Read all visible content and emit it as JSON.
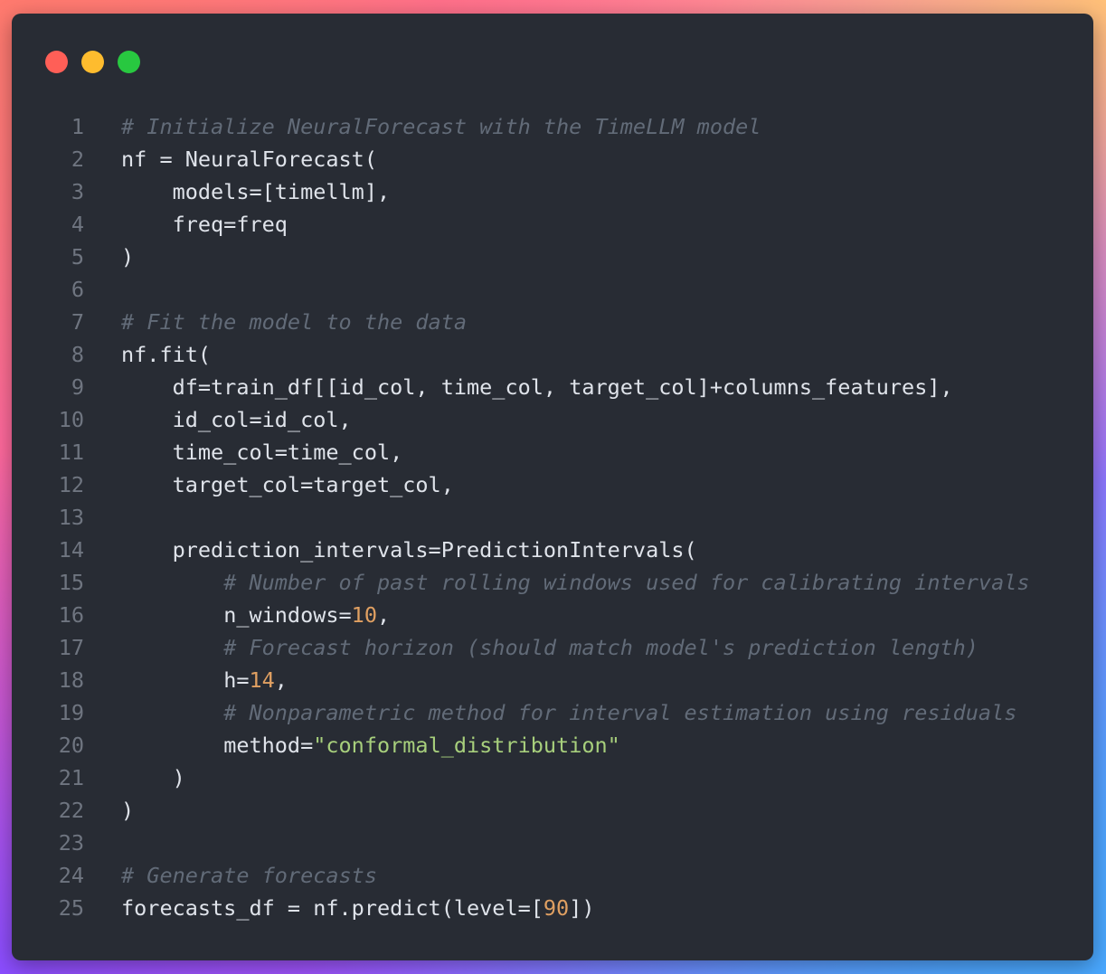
{
  "window": {
    "controls": [
      {
        "name": "close",
        "color": "#ff5f57"
      },
      {
        "name": "minimize",
        "color": "#febc2e"
      },
      {
        "name": "zoom",
        "color": "#28c840"
      }
    ]
  },
  "colors": {
    "background": "#282c34",
    "comment": "#626b78",
    "number": "#e0a062",
    "string": "#a7cf7c",
    "text": "#dfe3ea",
    "line_number": "#6f7580"
  },
  "code": {
    "lines": [
      {
        "n": "1",
        "indent": "",
        "tokens": [
          {
            "t": "comment",
            "v": "# Initialize NeuralForecast with the TimeLLM model"
          }
        ]
      },
      {
        "n": "2",
        "indent": "",
        "tokens": [
          {
            "t": "plain",
            "v": "nf = NeuralForecast("
          }
        ]
      },
      {
        "n": "3",
        "indent": "    ",
        "tokens": [
          {
            "t": "plain",
            "v": "models=[timellm],"
          }
        ]
      },
      {
        "n": "4",
        "indent": "    ",
        "tokens": [
          {
            "t": "plain",
            "v": "freq=freq"
          }
        ]
      },
      {
        "n": "5",
        "indent": "",
        "tokens": [
          {
            "t": "plain",
            "v": ")"
          }
        ]
      },
      {
        "n": "6",
        "indent": "",
        "tokens": []
      },
      {
        "n": "7",
        "indent": "",
        "tokens": [
          {
            "t": "comment",
            "v": "# Fit the model to the data"
          }
        ]
      },
      {
        "n": "8",
        "indent": "",
        "tokens": [
          {
            "t": "plain",
            "v": "nf.fit("
          }
        ]
      },
      {
        "n": "9",
        "indent": "    ",
        "tokens": [
          {
            "t": "plain",
            "v": "df=train_df[[id_col, time_col, target_col]+columns_features],"
          }
        ]
      },
      {
        "n": "10",
        "indent": "    ",
        "tokens": [
          {
            "t": "plain",
            "v": "id_col=id_col,"
          }
        ]
      },
      {
        "n": "11",
        "indent": "    ",
        "tokens": [
          {
            "t": "plain",
            "v": "time_col=time_col,"
          }
        ]
      },
      {
        "n": "12",
        "indent": "    ",
        "tokens": [
          {
            "t": "plain",
            "v": "target_col=target_col,"
          }
        ]
      },
      {
        "n": "13",
        "indent": "",
        "tokens": []
      },
      {
        "n": "14",
        "indent": "    ",
        "tokens": [
          {
            "t": "plain",
            "v": "prediction_intervals=PredictionIntervals("
          }
        ]
      },
      {
        "n": "15",
        "indent": "        ",
        "tokens": [
          {
            "t": "comment",
            "v": "# Number of past rolling windows used for calibrating intervals"
          }
        ]
      },
      {
        "n": "16",
        "indent": "        ",
        "tokens": [
          {
            "t": "plain",
            "v": "n_windows="
          },
          {
            "t": "number",
            "v": "10"
          },
          {
            "t": "plain",
            "v": ","
          }
        ]
      },
      {
        "n": "17",
        "indent": "        ",
        "tokens": [
          {
            "t": "comment",
            "v": "# Forecast horizon (should match model's prediction length)"
          }
        ]
      },
      {
        "n": "18",
        "indent": "        ",
        "tokens": [
          {
            "t": "plain",
            "v": "h="
          },
          {
            "t": "number",
            "v": "14"
          },
          {
            "t": "plain",
            "v": ","
          }
        ]
      },
      {
        "n": "19",
        "indent": "        ",
        "tokens": [
          {
            "t": "comment",
            "v": "# Nonparametric method for interval estimation using residuals"
          }
        ]
      },
      {
        "n": "20",
        "indent": "        ",
        "tokens": [
          {
            "t": "plain",
            "v": "method="
          },
          {
            "t": "string",
            "v": "\"conformal_distribution\""
          }
        ]
      },
      {
        "n": "21",
        "indent": "    ",
        "tokens": [
          {
            "t": "plain",
            "v": ")"
          }
        ]
      },
      {
        "n": "22",
        "indent": "",
        "tokens": [
          {
            "t": "plain",
            "v": ")"
          }
        ]
      },
      {
        "n": "23",
        "indent": "",
        "tokens": []
      },
      {
        "n": "24",
        "indent": "",
        "tokens": [
          {
            "t": "comment",
            "v": "# Generate forecasts"
          }
        ]
      },
      {
        "n": "25",
        "indent": "",
        "tokens": [
          {
            "t": "plain",
            "v": "forecasts_df = nf.predict(level=["
          },
          {
            "t": "number",
            "v": "90"
          },
          {
            "t": "plain",
            "v": "])"
          }
        ]
      }
    ]
  }
}
